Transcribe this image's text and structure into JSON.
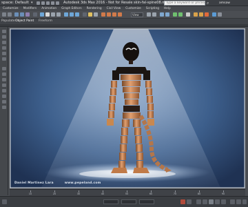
{
  "titlebar": {
    "workspace_label": "space: Default",
    "title": "Autodesk 3ds Max 2016 - Not for Resale    skin-fal-spine08.max",
    "search_placeholder": "Type a keyword or phrase",
    "user_label": "amsaw"
  },
  "menu": {
    "items": [
      "Customize",
      "Modifiers",
      "Animation",
      "Graph Editors",
      "Rendering",
      "Civil View",
      "Customize",
      "Scripting",
      "Help"
    ]
  },
  "toolbar": {
    "view_label": "View"
  },
  "ribbon": {
    "tabs": [
      "Populate",
      "Object Paint",
      "Freeform"
    ]
  },
  "viewport": {
    "caption_name": "Daniel Martinez Lara",
    "caption_site": "www.pepeland.com"
  },
  "timeline": {
    "ticks": [
      "10",
      "20",
      "30",
      "40",
      "50",
      "60",
      "70",
      "80",
      "90"
    ]
  },
  "colors": {
    "ui_dark": "#3c3f44",
    "viewport_bg": "#3f5f8a",
    "character_skin": "#c88a5a",
    "character_dark": "#1a1412"
  },
  "icons": {
    "workspace_chevron": "chevron-down-icon",
    "search": "search-icon",
    "play": "play-icon"
  }
}
